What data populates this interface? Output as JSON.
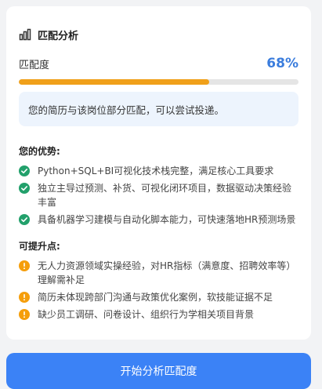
{
  "card": {
    "title": "匹配分析",
    "title_icon": "bar-chart-icon",
    "score_label": "匹配度",
    "score_value": "68%",
    "progress": 0.68,
    "notice": "您的简历与该岗位部分匹配，可以尝试投递。"
  },
  "strengths": {
    "title": "您的优势:",
    "icon": "check-circle-icon",
    "icon_color": "#22a06b",
    "items": [
      "Python+SQL+BI可视化技术栈完整，满足核心工具要求",
      "独立主导过预测、补货、可视化闭环项目，数据驱动决策经验丰富",
      "具备机器学习建模与自动化脚本能力，可快速落地HR预测场景"
    ]
  },
  "improvements": {
    "title": "可提升点:",
    "icon": "exclamation-circle-icon",
    "icon_color": "#f59e0b",
    "items": [
      "无人力资源领域实操经验，对HR指标（满意度、招聘效率等）理解需补足",
      "简历未体现跨部门沟通与政策优化案例，软技能证据不足",
      "缺少员工调研、问卷设计、组织行为学相关项目背景"
    ]
  },
  "action_button": "开始分析匹配度",
  "colors": {
    "accent": "#3b7ddd",
    "progress": "#f0a01a",
    "button": "#3b82f6"
  }
}
